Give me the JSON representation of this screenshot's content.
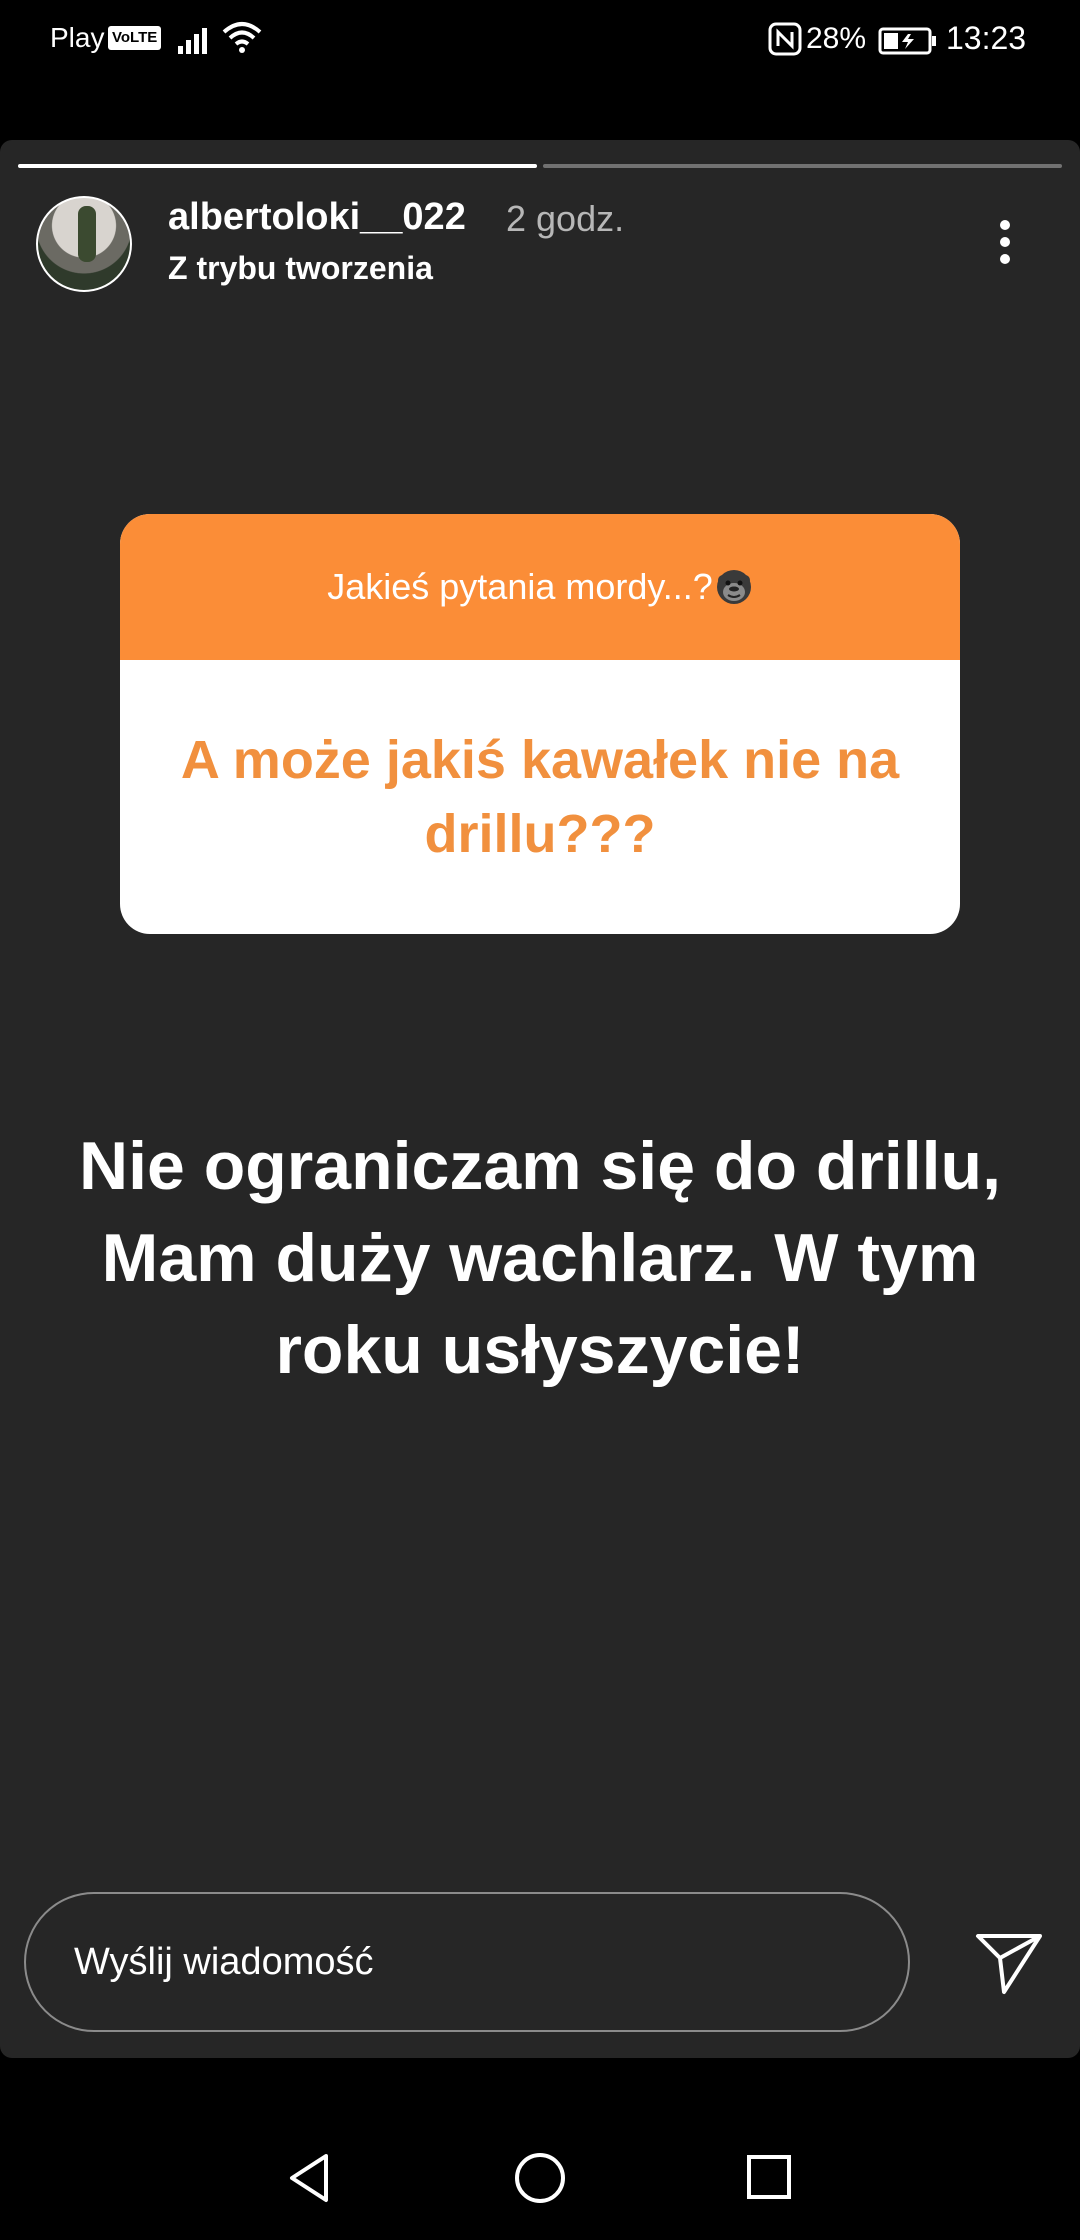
{
  "status_bar": {
    "carrier": "Play",
    "volte": "VoLTE",
    "battery_percent": "28%",
    "time": "13:23",
    "icons": [
      "signal-icon",
      "wifi-icon",
      "nfc-icon",
      "battery-charging-icon"
    ]
  },
  "story": {
    "progress": {
      "segments_done": 1,
      "segments_total": 2,
      "current_fraction": 0.5
    },
    "username": "albertoloki__022",
    "time_ago": "2 godz.",
    "subtitle": "Z trybu tworzenia",
    "question_sticker": {
      "prompt": "Jakieś pytania mordy...?",
      "prompt_emoji": "gorilla-emoji",
      "question": "A może jakiś kawałek nie na drillu???",
      "header_color": "#fb8d37",
      "question_color": "#f1903e"
    },
    "answer_text": "Nie ograniczam się do drillu, Mam duży wachlarz. W tym roku usłyszycie!",
    "reply": {
      "placeholder": "Wyślij wiadomość"
    }
  },
  "colors": {
    "story_bg": "#262626",
    "screen_bg": "#000000"
  }
}
